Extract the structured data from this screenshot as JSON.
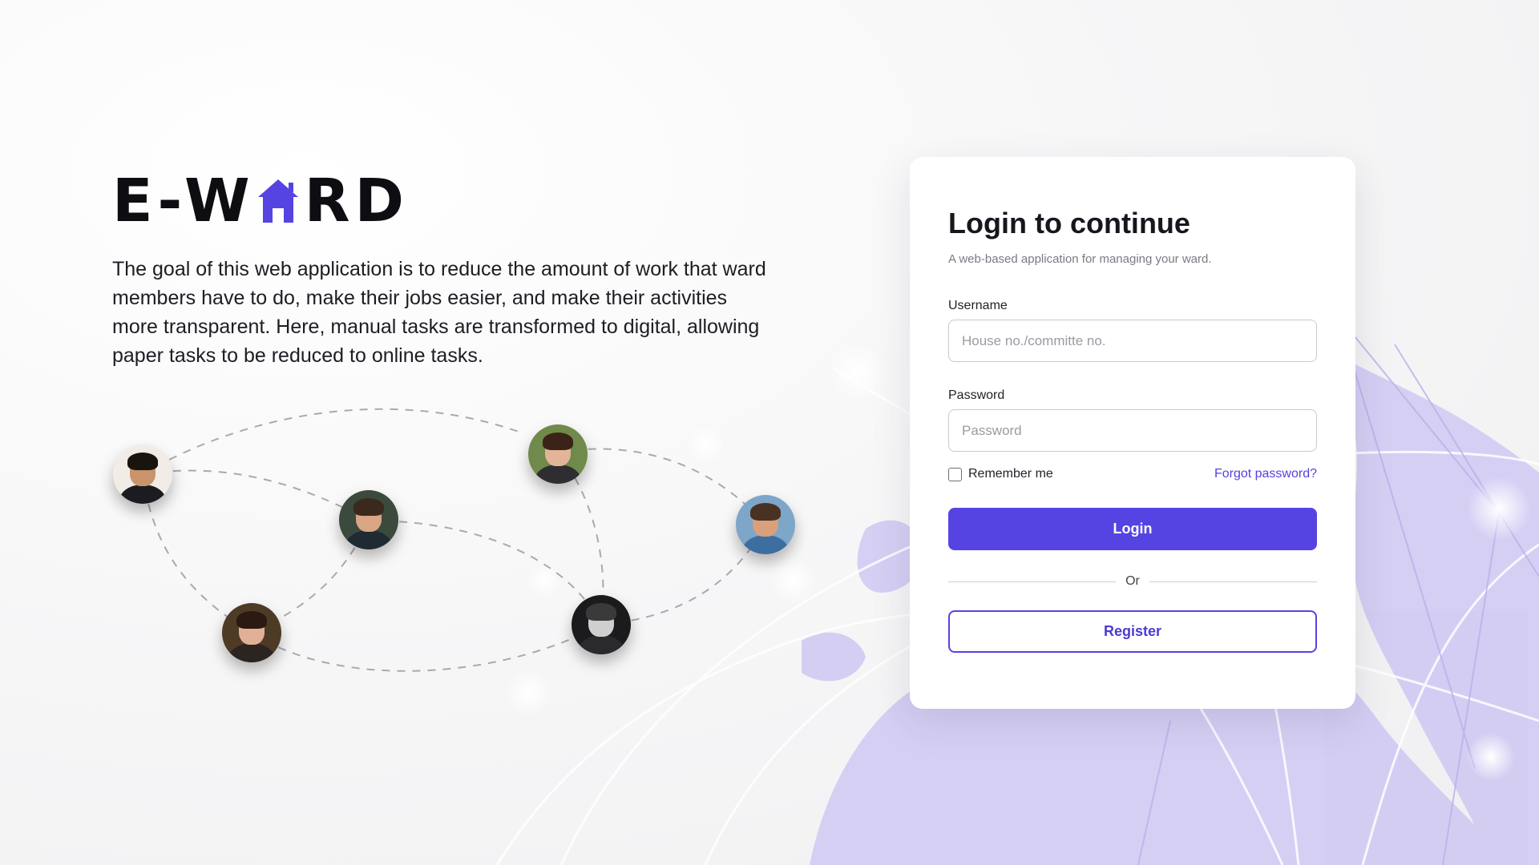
{
  "brand": {
    "prefix": "E-W",
    "suffix": "RD",
    "logo_icon": "house-icon",
    "accent_color": "#5544e2"
  },
  "description": "The goal of this web application is to reduce the amount of work that ward members have to do, make their jobs easier, and make their activities more transparent. Here, manual tasks are transformed to digital, allowing paper tasks to be reduced to online tasks.",
  "network": {
    "avatars": [
      "avatar-1",
      "avatar-2",
      "avatar-3",
      "avatar-4",
      "avatar-5",
      "avatar-6",
      "avatar-7"
    ]
  },
  "login_card": {
    "title": "Login to continue",
    "subtitle": "A web-based application for managing your ward.",
    "username_label": "Username",
    "username_placeholder": "House no./committe no.",
    "password_label": "Password",
    "password_placeholder": "Password",
    "remember_label": "Remember me",
    "forgot_label": "Forgot password?",
    "login_label": "Login",
    "divider_label": "Or",
    "register_label": "Register"
  },
  "colors": {
    "primary": "#5544e2",
    "globe": "#cfc8f2"
  }
}
